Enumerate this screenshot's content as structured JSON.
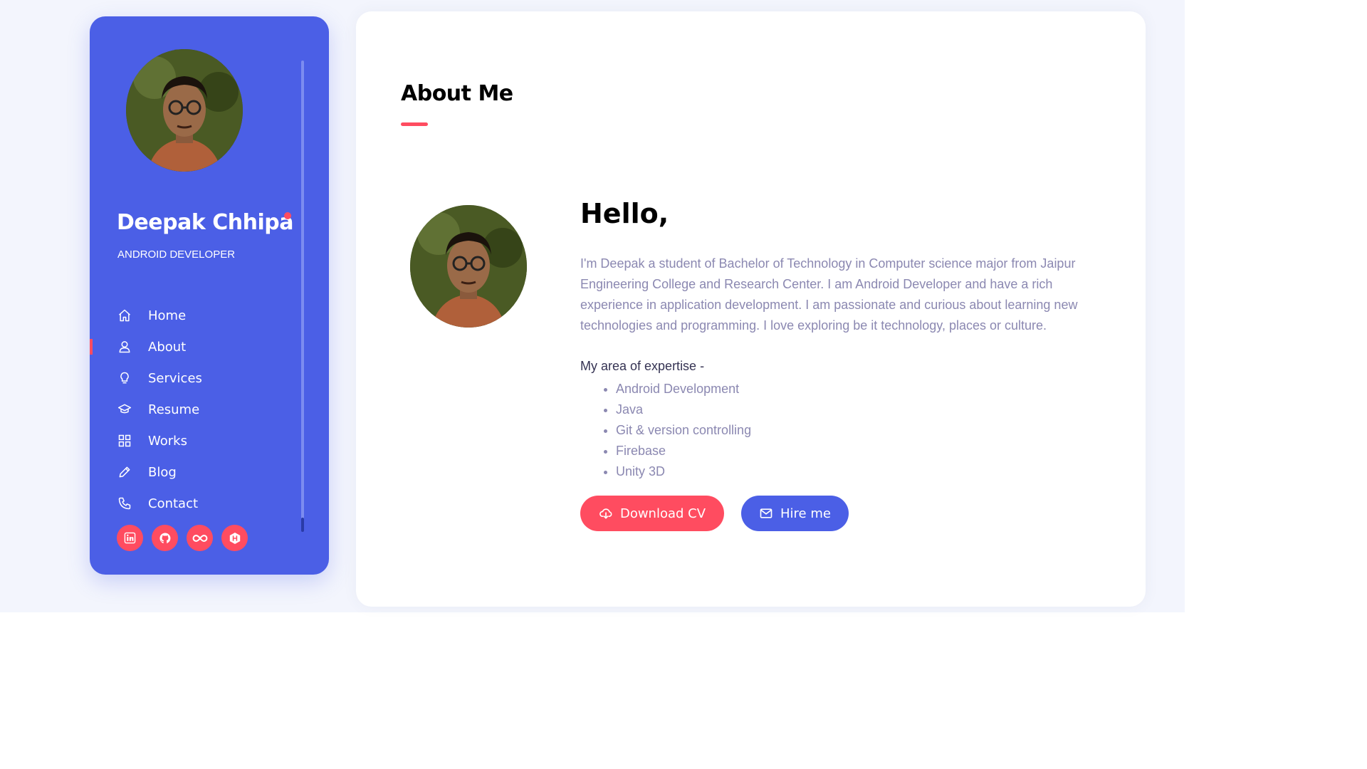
{
  "sidebar": {
    "name": "Deepak Chhipa",
    "role": "ANDROID DEVELOPER",
    "nav": [
      {
        "label": "Home",
        "icon": "home-icon"
      },
      {
        "label": "About",
        "icon": "user-icon",
        "active": true
      },
      {
        "label": "Services",
        "icon": "lightbulb-icon"
      },
      {
        "label": "Resume",
        "icon": "graduation-cap-icon"
      },
      {
        "label": "Works",
        "icon": "grid-icon"
      },
      {
        "label": "Blog",
        "icon": "pencil-icon"
      },
      {
        "label": "Contact",
        "icon": "phone-icon"
      }
    ],
    "social": [
      "linkedin-icon",
      "github-icon",
      "infinity-icon",
      "hackerrank-icon"
    ]
  },
  "about": {
    "title": "About Me",
    "hello": "Hello,",
    "bio": "I'm Deepak a student of Bachelor of Technology in Computer science major from Jaipur Engineering College and Research Center. I am Android Developer and have a rich experience in application development. I am passionate and curious about learning new technologies and programming. I love exploring be it technology, places or culture.",
    "expertise_heading": "My area of expertise -",
    "expertise": [
      "Android Development",
      "Java",
      "Git & version controlling",
      "Firebase",
      "Unity 3D"
    ],
    "download_label": "Download CV",
    "hire_label": "Hire me"
  },
  "colors": {
    "primary": "#4b5fe6",
    "accent": "#ff4c60",
    "text_muted": "#8b88b1",
    "background": "#f3f5fd"
  }
}
